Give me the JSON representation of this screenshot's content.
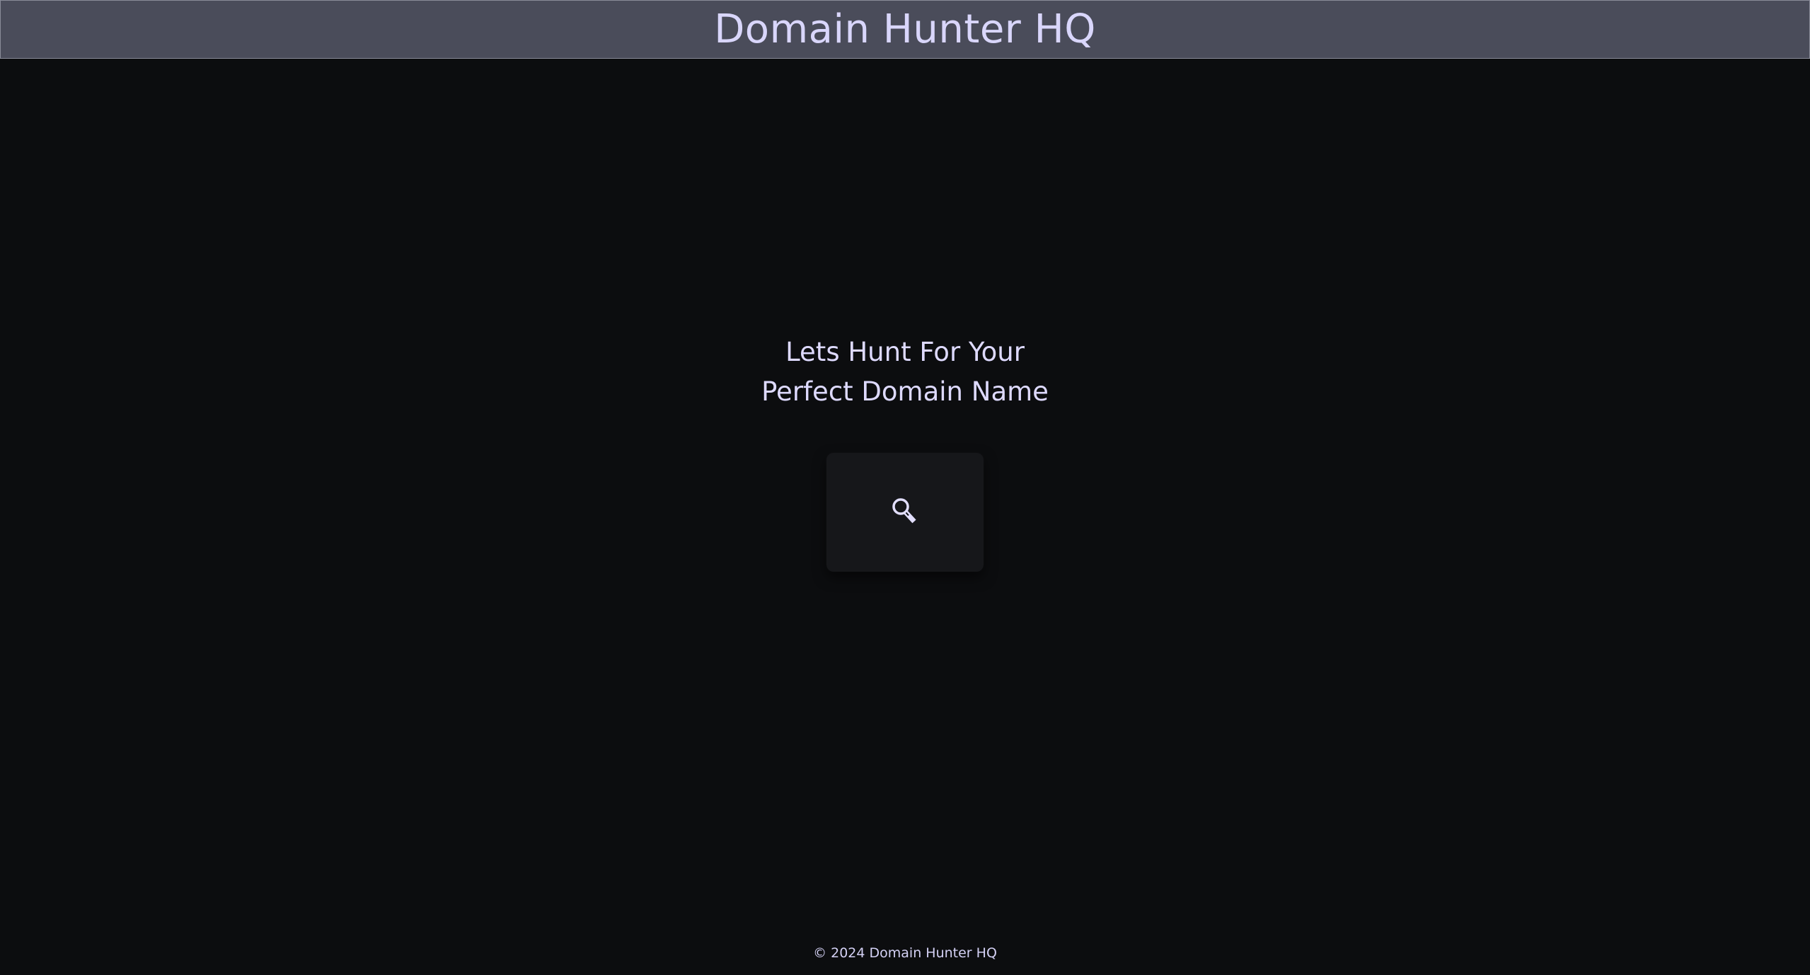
{
  "header": {
    "title": "Domain Hunter HQ"
  },
  "hero": {
    "tagline_line1": "Lets Hunt For Your",
    "tagline_line2": "Perfect Domain Name"
  },
  "search_button": {
    "icon": "magnifier-icon"
  },
  "footer": {
    "copyright": "© 2024 Domain Hunter HQ"
  },
  "colors": {
    "header_bg": "#4a4c5a",
    "page_bg": "#0c0d0f",
    "text": "#d9d6fb",
    "card_bg": "#16171a"
  }
}
